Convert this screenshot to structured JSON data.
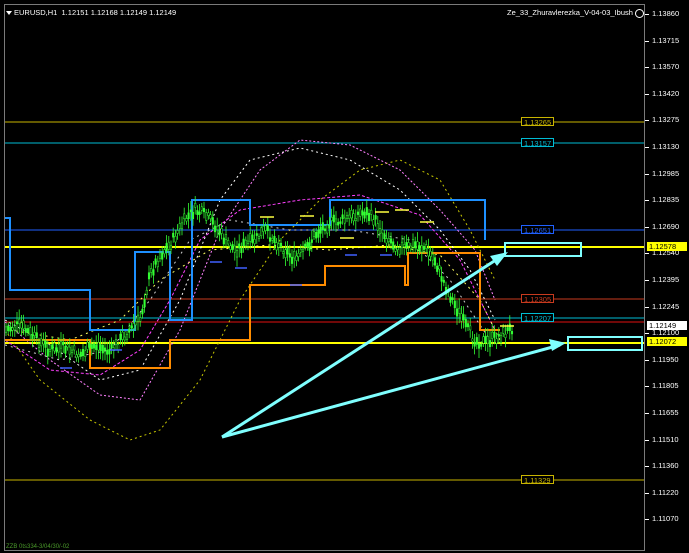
{
  "chart": {
    "header_symbol": "EURUSD,H1",
    "header_ohlc": "1.12151 1.12168 1.12149 1.12149",
    "indicator_name": "Ze_33_Zhuravlerezka_V-04-03_Ibush",
    "smiley_icon": "smiley-icon",
    "footer_text": "ZZB 0ts334-3/04/30/-02"
  },
  "price_axis": {
    "ticks": [
      "1.13860",
      "1.13715",
      "1.13570",
      "1.13420",
      "1.13275",
      "1.13130",
      "1.12985",
      "1.12835",
      "1.12690",
      "1.12540",
      "1.12395",
      "1.12245",
      "1.12100",
      "1.11950",
      "1.11805",
      "1.11655",
      "1.11510",
      "1.11360",
      "1.11220",
      "1.11070"
    ],
    "current_price": "1.12149",
    "tags": [
      {
        "text": "1.12578",
        "bg": "#ffff00",
        "fg": "#000000"
      },
      {
        "text": "1.12149",
        "bg": "#ffffff",
        "fg": "#000000"
      },
      {
        "text": "1.12072",
        "bg": "#ffff00",
        "fg": "#000000"
      }
    ]
  },
  "levels": [
    {
      "text": "1.13265",
      "color": "#c8b400"
    },
    {
      "text": "1.13157",
      "color": "#00bcd4"
    },
    {
      "text": "1.12651",
      "color": "#2060ff"
    },
    {
      "text": "1.12578",
      "color": "#ffff00"
    },
    {
      "text": "1.12305",
      "color": "#c83a1e"
    },
    {
      "text": "1.12207",
      "color": "#00bcd4"
    },
    {
      "text": "1.12072",
      "color": "#ffff00"
    },
    {
      "text": "1.11329",
      "color": "#c8b400"
    }
  ],
  "colors": {
    "background": "#000000",
    "candles": "#33ff33",
    "arrows": "#7fffff",
    "orange_channel": "#ff8c00",
    "blue_channel": "#1e90ff"
  }
}
